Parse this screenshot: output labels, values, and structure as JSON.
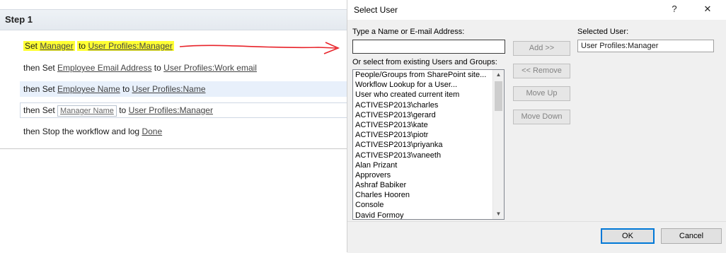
{
  "workflow": {
    "step_title": "Step 1",
    "line1": {
      "set": "Set",
      "field": "Manager",
      "to": "to",
      "value": "User Profiles:Manager"
    },
    "line2": {
      "prefix": "then Set",
      "field": "Employee Email Address",
      "to": "to",
      "value": "User Profiles:Work email"
    },
    "line3": {
      "prefix": "then Set",
      "field": "Employee Name",
      "to": "to",
      "value": "User Profiles:Name"
    },
    "line4": {
      "prefix": "then Set",
      "field": "Manager Name",
      "to": "to",
      "value": "User Profiles:Manager"
    },
    "line5": {
      "prefix": "then Stop the workflow and log",
      "value": "Done"
    },
    "highlight_color": "#ffff33",
    "arrow_color": "#e8232a"
  },
  "dialog": {
    "title": "Select User",
    "help_icon": "?",
    "close_icon": "✕",
    "name_label": "Type a Name or E-mail Address:",
    "name_value": "",
    "existing_label": "Or select from existing Users and Groups:",
    "list_items": [
      "People/Groups from SharePoint site...",
      "Workflow Lookup for a User...",
      "User who created current item",
      "ACTIVESP2013\\charles",
      "ACTIVESP2013\\gerard",
      "ACTIVESP2013\\kate",
      "ACTIVESP2013\\piotr",
      "ACTIVESP2013\\priyanka",
      "ACTIVESP2013\\vaneeth",
      "Alan Prizant",
      "Approvers",
      "Ashraf Babiker",
      "Charles Hooren",
      "Console",
      "David Formoy"
    ],
    "add_button": "Add >>",
    "remove_button": "<< Remove",
    "move_up_button": "Move Up",
    "move_down_button": "Move Down",
    "selected_label": "Selected User:",
    "selected_value": "User Profiles:Manager",
    "ok_button": "OK",
    "cancel_button": "Cancel"
  }
}
